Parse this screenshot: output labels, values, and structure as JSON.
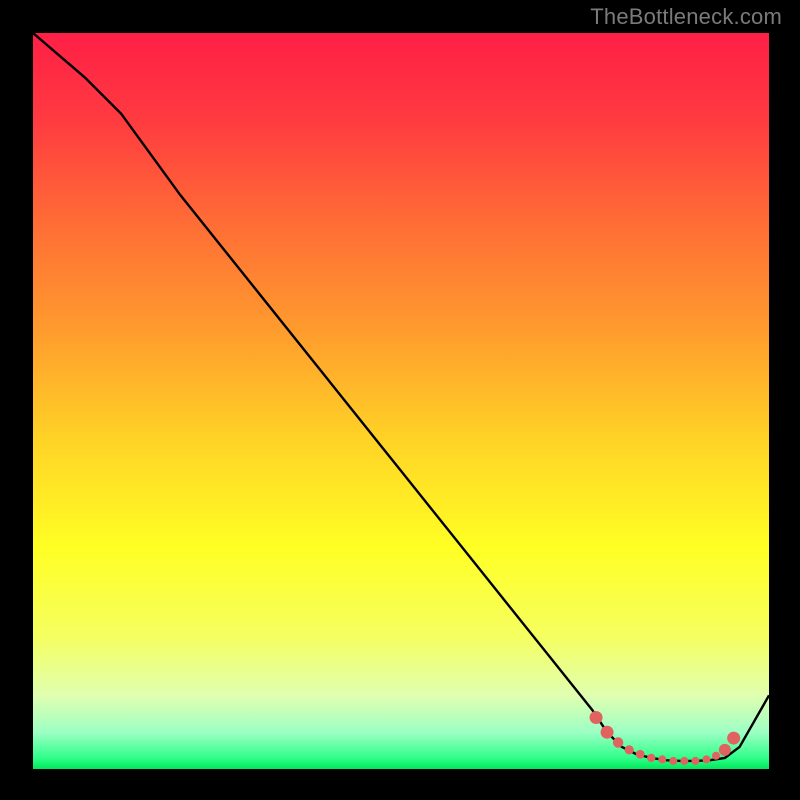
{
  "watermark": "TheBottleneck.com",
  "colors": {
    "background": "#000000",
    "curve": "#000000",
    "marker_fill": "#e2625f",
    "marker_stroke": "#d64b47",
    "gradient_stops": [
      {
        "offset": 0.0,
        "color": "#ff1f46"
      },
      {
        "offset": 0.12,
        "color": "#ff3b40"
      },
      {
        "offset": 0.25,
        "color": "#ff6a36"
      },
      {
        "offset": 0.4,
        "color": "#ff9a2e"
      },
      {
        "offset": 0.55,
        "color": "#ffd226"
      },
      {
        "offset": 0.7,
        "color": "#ffff24"
      },
      {
        "offset": 0.82,
        "color": "#f5ff60"
      },
      {
        "offset": 0.9,
        "color": "#e0ffb0"
      },
      {
        "offset": 0.95,
        "color": "#9dffc4"
      },
      {
        "offset": 0.985,
        "color": "#30ff8a"
      },
      {
        "offset": 1.0,
        "color": "#00e85a"
      }
    ]
  },
  "chart_data": {
    "type": "line",
    "title": "",
    "xlabel": "",
    "ylabel": "",
    "xlim": [
      0,
      100
    ],
    "ylim": [
      0,
      100
    ],
    "series": [
      {
        "name": "curve",
        "x": [
          0,
          7,
          12,
          20,
          30,
          40,
          50,
          60,
          70,
          76,
          78,
          80,
          82,
          84,
          86,
          88,
          90,
          92,
          94,
          96,
          100
        ],
        "y": [
          100,
          94,
          89,
          78,
          65.5,
          53,
          40.5,
          28,
          15.5,
          8,
          5,
          3,
          2,
          1.5,
          1.2,
          1.1,
          1.1,
          1.2,
          1.5,
          3,
          10
        ]
      }
    ],
    "markers": {
      "name": "highlight",
      "x": [
        76.5,
        78,
        79.5,
        81,
        82.5,
        84,
        85.5,
        87,
        88.5,
        90,
        91.5,
        92.8,
        94,
        95.2
      ],
      "y": [
        7.0,
        5.0,
        3.6,
        2.6,
        2.0,
        1.5,
        1.3,
        1.1,
        1.1,
        1.1,
        1.3,
        1.8,
        2.6,
        4.2
      ],
      "r": [
        6.5,
        6.5,
        5.2,
        4.6,
        4.4,
        4.2,
        4.0,
        4.0,
        4.0,
        4.0,
        4.0,
        4.0,
        6.0,
        6.5
      ]
    }
  }
}
